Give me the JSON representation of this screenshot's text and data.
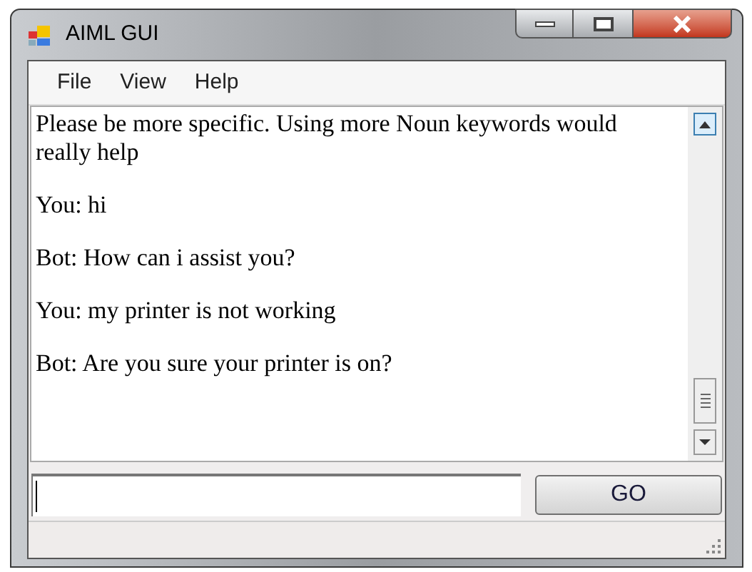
{
  "window": {
    "title": "AIML GUI"
  },
  "menu": [
    "File",
    "View",
    "Help"
  ],
  "messages": [
    "Please be more specific. Using more Noun keywords would really help",
    "You: hi",
    "Bot: How can i assist you?",
    "You: my printer is not working",
    "Bot: Are you sure your printer is on?"
  ],
  "go_button": "GO"
}
